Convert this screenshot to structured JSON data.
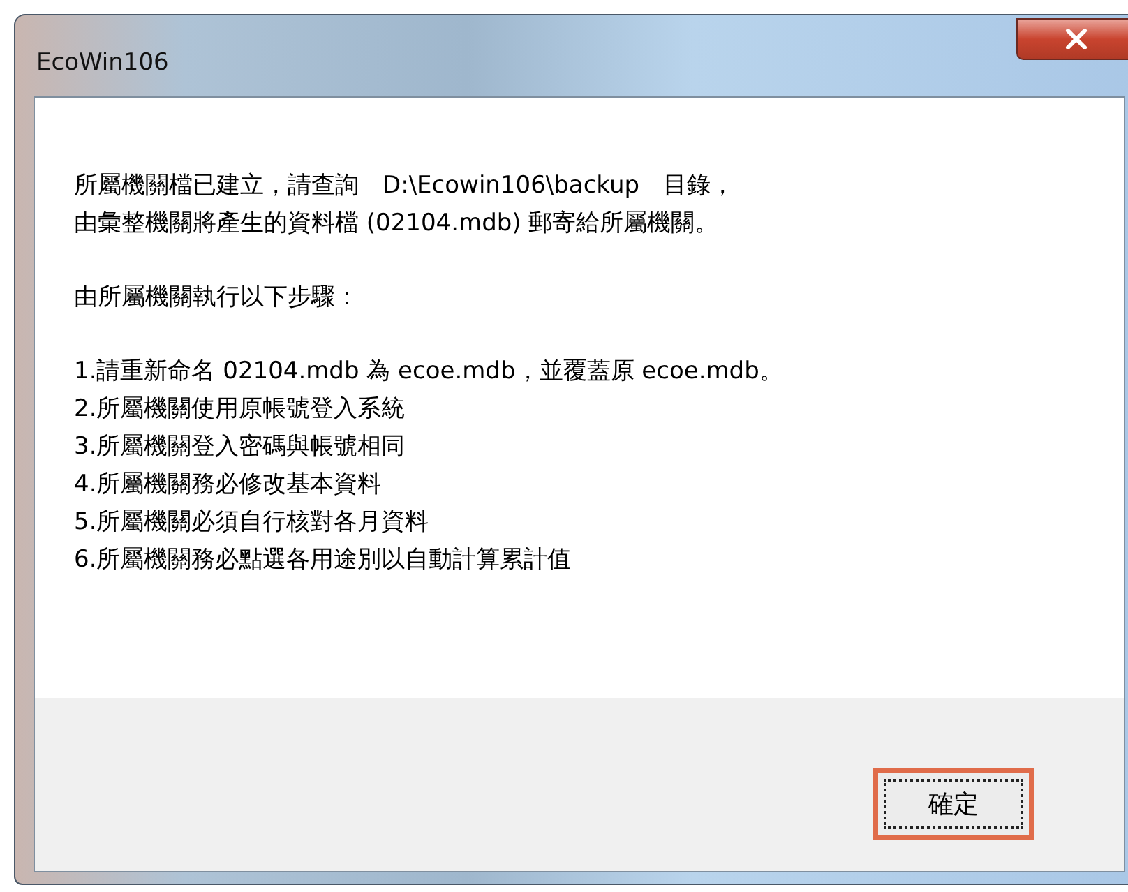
{
  "window": {
    "title": "EcoWin106"
  },
  "message": {
    "paragraphs": [
      [
        "所屬機關檔已建立，請查詢　D:\\Ecowin106\\backup　目錄，",
        "由彙整機關將產生的資料檔 (02104.mdb) 郵寄給所屬機關。"
      ],
      [
        "由所屬機關執行以下步驟："
      ],
      [
        "1.請重新命名 02104.mdb 為 ecoe.mdb，並覆蓋原 ecoe.mdb。",
        "2.所屬機關使用原帳號登入系統",
        "3.所屬機關登入密碼與帳號相同",
        "4.所屬機關務必修改基本資料",
        "5.所屬機關必須自行核對各月資料",
        "6.所屬機關務必點選各用途別以自動計算累計值"
      ]
    ]
  },
  "buttons": [
    {
      "label": "確定",
      "focused": true
    }
  ]
}
